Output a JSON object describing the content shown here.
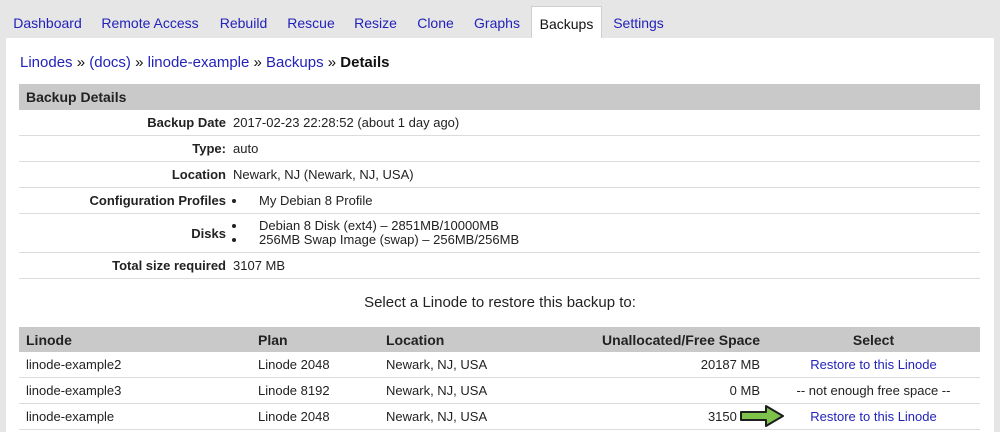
{
  "tabs": [
    {
      "label": "Dashboard"
    },
    {
      "label": "Remote Access"
    },
    {
      "label": "Rebuild"
    },
    {
      "label": "Rescue"
    },
    {
      "label": "Resize"
    },
    {
      "label": "Clone"
    },
    {
      "label": "Graphs"
    },
    {
      "label": "Backups",
      "active": true
    },
    {
      "label": "Settings"
    }
  ],
  "breadcrumb": {
    "items": [
      "Linodes",
      "(docs)",
      "linode-example",
      "Backups"
    ],
    "current": "Details",
    "separator": "»"
  },
  "backup_details": {
    "title": "Backup Details",
    "date_label": "Backup Date",
    "date_value": "2017-02-23 22:28:52 (about 1 day ago)",
    "type_label": "Type:",
    "type_value": "auto",
    "location_label": "Location",
    "location_value": "Newark, NJ (Newark, NJ, USA)",
    "profiles_label": "Configuration Profiles",
    "profiles": [
      "My Debian 8 Profile"
    ],
    "disks_label": "Disks",
    "disks": [
      "Debian 8 Disk (ext4) – 2851MB/10000MB",
      "256MB Swap Image (swap) – 256MB/256MB"
    ],
    "total_label": "Total size required",
    "total_value": "3107 MB"
  },
  "restore": {
    "prompt": "Select a Linode to restore this backup to:",
    "columns": [
      "Linode",
      "Plan",
      "Location",
      "Unallocated/Free Space",
      "Select"
    ],
    "rows": [
      {
        "linode": "linode-example2",
        "plan": "Linode 2048",
        "location": "Newark, NJ, USA",
        "free": "20187 MB",
        "select": "Restore to this Linode",
        "selectable": true
      },
      {
        "linode": "linode-example3",
        "plan": "Linode 8192",
        "location": "Newark, NJ, USA",
        "free": "0 MB",
        "select": "-- not enough free space --",
        "selectable": false
      },
      {
        "linode": "linode-example",
        "plan": "Linode 2048",
        "location": "Newark, NJ, USA",
        "free": "3150 MB",
        "select": "Restore to this Linode",
        "selectable": true
      }
    ]
  },
  "colors": {
    "link": "#2222bb",
    "header_bg": "#c9c9c9",
    "arrow_fill": "#7dc24a"
  }
}
